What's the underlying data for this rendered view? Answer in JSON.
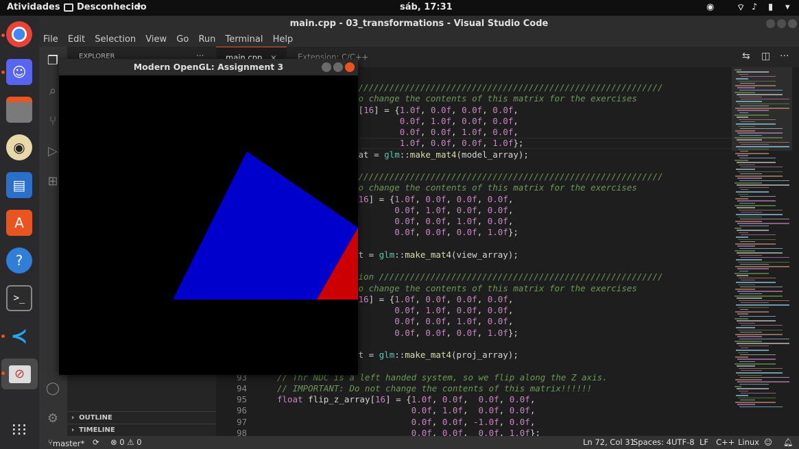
{
  "topbar": {
    "activities": "Atividades",
    "app": "Desconhecido",
    "clock": "sáb, 17:31"
  },
  "window": {
    "title": "main.cpp - 03_transformations - Visual Studio Code"
  },
  "menu": [
    "File",
    "Edit",
    "Selection",
    "View",
    "Go",
    "Run",
    "Terminal",
    "Help"
  ],
  "sidebar": {
    "title": "EXPLORER",
    "outline": "OUTLINE",
    "timeline": "TIMELINE"
  },
  "tabs": [
    {
      "label": "main.cpp"
    },
    {
      "label": "Extension: C/C++"
    }
  ],
  "glwindow": {
    "title": "Modern OpenGL: Assignment 3"
  },
  "code": [
    {
      "n": "",
      "t": "////////////////////////////////////////////////////////////"
    },
    {
      "n": "",
      "t": "to change the contents of this matrix for the exercises"
    },
    {
      "n": "",
      "t": "y[16] = {1.0f, 0.0f, 0.0f, 0.0f,"
    },
    {
      "n": "",
      "t": "         0.0f, 1.0f, 0.0f, 0.0f,"
    },
    {
      "n": "",
      "t": "         0.0f, 0.0f, 1.0f, 0.0f,"
    },
    {
      "n": "",
      "t": "         1.0f, 0.0f, 0.0f, 1.0f};"
    },
    {
      "n": "",
      "t": "mat = glm::make_mat4(model_array);"
    },
    {
      "n": "",
      "t": ""
    },
    {
      "n": "",
      "t": "////////////////////////////////////////////////////////////"
    },
    {
      "n": "",
      "t": "to change the contents of this matrix for the exercises"
    },
    {
      "n": "",
      "t": "[16] = {1.0f, 0.0f, 0.0f, 0.0f,"
    },
    {
      "n": "",
      "t": "        0.0f, 1.0f, 0.0f, 0.0f,"
    },
    {
      "n": "",
      "t": "        0.0f, 0.0f, 1.0f, 0.0f,"
    },
    {
      "n": "",
      "t": "        0.0f, 0.0f, 0.0f, 1.0f};"
    },
    {
      "n": "",
      "t": ""
    },
    {
      "n": "",
      "t": "at = glm::make_mat4(view_array);"
    },
    {
      "n": "",
      "t": ""
    },
    {
      "n": "",
      "t": "tion ///////////////////////////////////////////////////////"
    },
    {
      "n": "",
      "t": "to change the contents of this matrix for the exercises"
    },
    {
      "n": "",
      "t": "[16] = {1.0f, 0.0f, 0.0f, 0.0f,"
    },
    {
      "n": "",
      "t": "        0.0f, 1.0f, 0.0f, 0.0f,"
    },
    {
      "n": "",
      "t": "        0.0f, 0.0f, 1.0f, 0.0f,"
    },
    {
      "n": "",
      "t": "        0.0f, 0.0f, 0.0f, 1.0f};"
    },
    {
      "n": "",
      "t": ""
    },
    {
      "n": "",
      "t": "at = glm::make_mat4(proj_array);"
    },
    {
      "n": "",
      "t": ""
    },
    {
      "n": "93",
      "t": "// Thr NDC is a left handed system, so we flip along the Z axis."
    },
    {
      "n": "94",
      "t": "// IMPORTANT: Do not change the contents of this matrix!!!!!!"
    },
    {
      "n": "95",
      "t": "float flip_z_array[16] = {1.0f, 0.0f,  0.0f, 0.0f,"
    },
    {
      "n": "96",
      "t": "                          0.0f, 1.0f,  0.0f, 0.0f,"
    },
    {
      "n": "97",
      "t": "                          0.0f, 0.0f, -1.0f, 0.0f,"
    },
    {
      "n": "98",
      "t": "                          0.0f, 0.0f,  0.0f, 1.0f};"
    }
  ],
  "status": {
    "branch": "master*",
    "problems": "⊗ 0 ⚠ 0",
    "position": "Ln 72, Col 31",
    "spaces": "Spaces: 4",
    "encoding": "UTF-8",
    "eol": "LF",
    "lang": "C++",
    "os": "Linux"
  },
  "colors": {
    "comment": "#6a9955",
    "keyword": "#c586c0",
    "string": "#ce9178",
    "function": "#dcdcaa",
    "number": "#b5cea8",
    "triangle_blue": "#0000cc",
    "triangle_red": "#cc0000"
  }
}
